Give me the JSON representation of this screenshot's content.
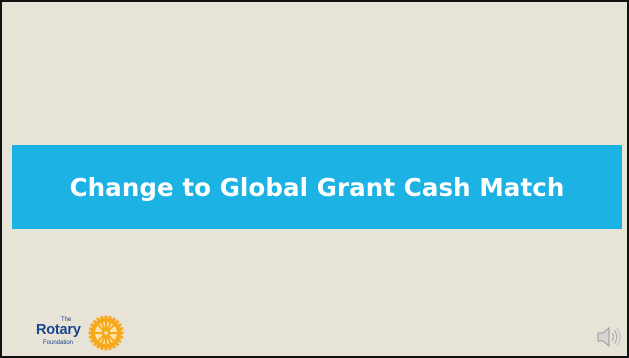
{
  "slide": {
    "title": "Change to Global Grant Cash Match",
    "background_color": "#e8e3d7",
    "band_color": "#1cb2e3",
    "title_color": "#ffffff"
  },
  "logo": {
    "small_text": "The",
    "wordmark": "Rotary",
    "subtitle": "Foundation",
    "brand_blue": "#17458f",
    "brand_gold": "#f7a81b"
  },
  "audio": {
    "icon": "speaker-icon"
  }
}
